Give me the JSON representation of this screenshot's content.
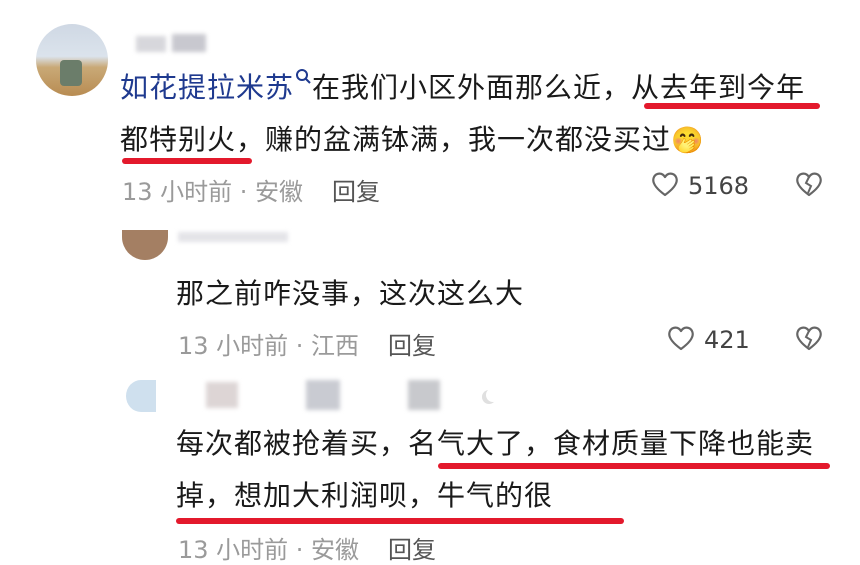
{
  "comments": [
    {
      "username": "如花提拉米苏",
      "text_line1": "在我们小区外面那么近，从去年到今年",
      "text_line2": "都特别火，赚的盆满钵满，我一次都没买过",
      "emoji": "🤭",
      "time": "13 小时前 · 安徽",
      "reply_label": "回复",
      "likes": "5168"
    },
    {
      "text_line1": "那之前咋没事，这次这么大",
      "time": "13 小时前 · 江西",
      "reply_label": "回复",
      "likes": "421"
    },
    {
      "text_line1": "每次都被抢着买，名气大了，食材质量下降也能卖",
      "text_line2": "掉，想加大利润呗，牛气的很",
      "time": "13 小时前 · 安徽",
      "reply_label": "回复"
    }
  ],
  "colors": {
    "highlight": "#e3192c",
    "username": "#1f3a8f"
  }
}
